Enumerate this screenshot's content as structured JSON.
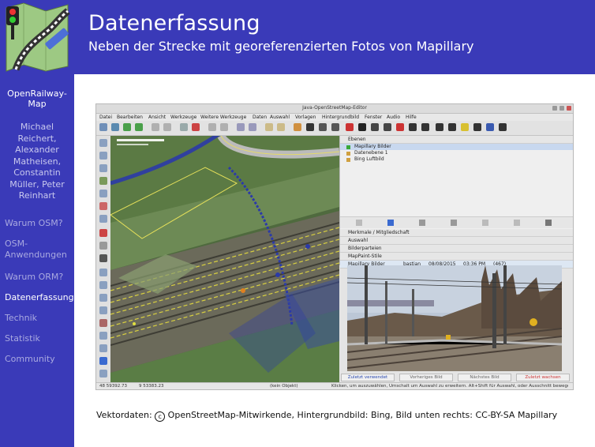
{
  "header": {
    "title": "Datenerfassung",
    "subtitle": "Neben der Strecke mit georeferenzierten Fotos von Mapillary"
  },
  "sidebar": {
    "project": "OpenRailway-Map",
    "authors": "Michael Reichert, Alexander Matheisen, Constantin Müller, Peter Reinhart",
    "nav": [
      {
        "label": "Warum OSM?"
      },
      {
        "label": "OSM-Anwendungen"
      },
      {
        "label": "Warum ORM?"
      },
      {
        "label": "Datenerfassung",
        "active": true
      },
      {
        "label": "Technik"
      },
      {
        "label": "Statistik"
      },
      {
        "label": "Community"
      }
    ]
  },
  "editor": {
    "window_title": "Java-OpenStreetMap-Editor",
    "menu": [
      "Datei",
      "Bearbeiten",
      "Ansicht",
      "Werkzeuge",
      "Weitere Werkzeuge",
      "Daten",
      "Auswahl",
      "Vorlagen",
      "Hintergrundbild",
      "Fenster",
      "Audio",
      "Hilfe"
    ],
    "layers_header": "Ebenen",
    "layers": [
      "Mapillary Bilder",
      "Datenebene 1",
      "Bing Luftbild"
    ],
    "panels": [
      "Merkmale / Mitgliedschaft",
      "Auswahl",
      "Bilderparteien",
      "MapPaint-Stile"
    ],
    "mapillary_panel": {
      "label": "Mapillary Bilder",
      "user": "bastian",
      "date": "08/08/2015",
      "time": "03:36 PM",
      "count": "(467)"
    },
    "photo_buttons": [
      "Zuletzt verwendet",
      "Vorheriges Bild",
      "Nächstes Bild",
      "Zuletzt wachsen"
    ],
    "status": {
      "lat": "48 59392.73",
      "lon": "9 53383.23",
      "edit": "(kein Objekt)",
      "hint": "Klicken, um auszuwählen, Umschalt um Auswahl zu erweitern. Alt+Shift für Auswahl, oder Ausschnitt bewegen."
    }
  },
  "caption": {
    "prefix": "Vektordaten:",
    "copyright_symbol": "c",
    "text": "OpenStreetMap-Mitwirkende, Hintergrundbild: Bing, Bild unten rechts: CC-BY-SA Mapillary"
  },
  "colors": {
    "slide_blue": "#3a3ab8",
    "nav_inactive": "#a9a9e0",
    "mapillary_green": "#39a839"
  }
}
